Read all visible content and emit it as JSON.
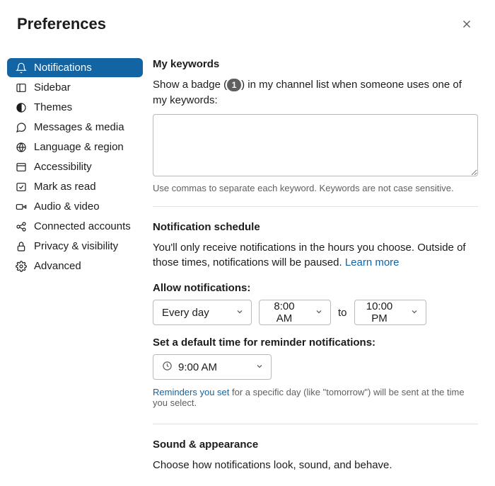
{
  "header": {
    "title": "Preferences"
  },
  "sidebar": {
    "items": [
      {
        "label": "Notifications"
      },
      {
        "label": "Sidebar"
      },
      {
        "label": "Themes"
      },
      {
        "label": "Messages & media"
      },
      {
        "label": "Language & region"
      },
      {
        "label": "Accessibility"
      },
      {
        "label": "Mark as read"
      },
      {
        "label": "Audio & video"
      },
      {
        "label": "Connected accounts"
      },
      {
        "label": "Privacy & visibility"
      },
      {
        "label": "Advanced"
      }
    ]
  },
  "keywords": {
    "title": "My keywords",
    "desc_before": "Show a badge (",
    "badge": "1",
    "desc_after": ") in my channel list when someone uses one of my keywords:",
    "value": "",
    "hint": "Use commas to separate each keyword. Keywords are not case sensitive."
  },
  "schedule": {
    "title": "Notification schedule",
    "desc": "You'll only receive notifications in the hours you choose. Outside of those times, notifications will be paused. ",
    "learn_more": "Learn more",
    "allow_label": "Allow notifications:",
    "day_value": "Every day",
    "start_value": "8:00 AM",
    "to_text": "to",
    "end_value": "10:00 PM",
    "reminder_label": "Set a default time for reminder notifications:",
    "reminder_value": "9:00 AM",
    "reminder_hint_link": "Reminders you set",
    "reminder_hint_rest": " for a specific day (like \"tomorrow\") will be sent at the time you select."
  },
  "sound": {
    "title": "Sound & appearance",
    "desc": "Choose how notifications look, sound, and behave."
  }
}
